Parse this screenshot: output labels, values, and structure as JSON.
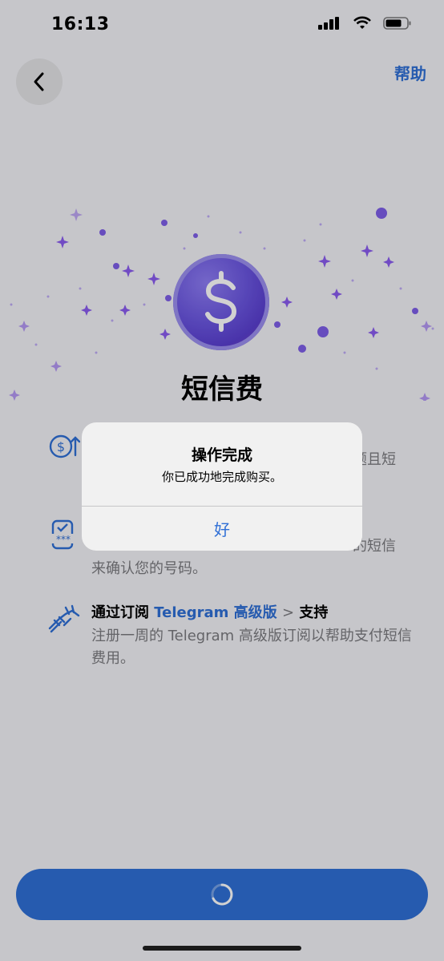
{
  "status_bar": {
    "time": "16:13"
  },
  "nav": {
    "help_label": "帮助"
  },
  "hero": {
    "title": "短信费"
  },
  "features": [
    {
      "title": "",
      "description_tail_1": "题且短",
      "description": ""
    },
    {
      "title": "",
      "description_tail": "的短信",
      "description_line2": "来确认您的号码。"
    },
    {
      "title_prefix": "通过订阅 ",
      "title_link": "Telegram 高级版",
      "title_arrow": ">",
      "title_suffix": " 支持",
      "description": "注册一周的 Telegram 高级版订阅以帮助支付短信费用。"
    }
  ],
  "alert": {
    "title": "操作完成",
    "message": "你已成功地完成购买。",
    "ok_label": "好"
  },
  "colors": {
    "accent": "#2f6fd6",
    "coin": "#6a55e0"
  }
}
